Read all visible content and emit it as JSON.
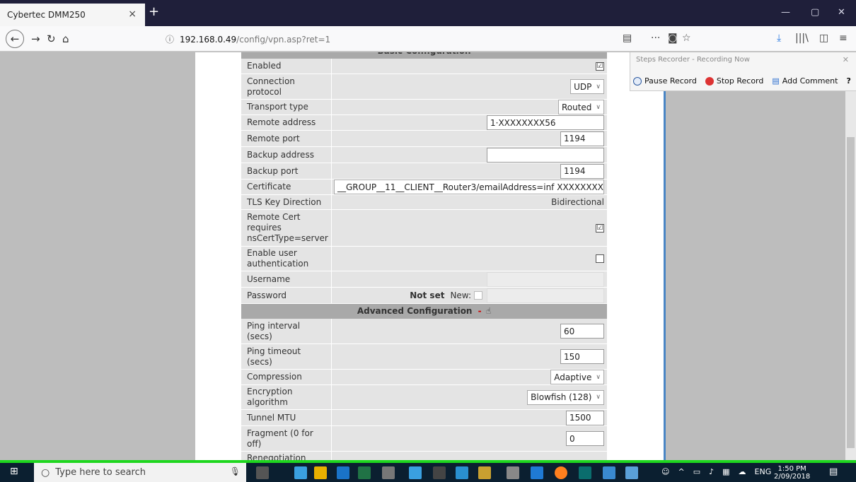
{
  "browser": {
    "tab_title": "Cybertec DMM250",
    "tab_close": "×",
    "new_tab": "+",
    "url_host": "192.168.0.49",
    "url_path": "/config/vpn.asp?ret=1",
    "win_min": "—",
    "win_max": "▢",
    "win_close": "✕"
  },
  "steps_recorder": {
    "title": "Steps Recorder - Recording Now",
    "pause": "Pause Record",
    "stop": "Stop Record",
    "comment": "Add Comment"
  },
  "form": {
    "basic_heading": "Basic Configuration",
    "rows": {
      "enabled": {
        "label": "Enabled",
        "checked": "☑"
      },
      "protocol": {
        "label": "Connection protocol",
        "value": "UDP"
      },
      "transport": {
        "label": "Transport type",
        "value": "Routed"
      },
      "remote_address": {
        "label": "Remote address",
        "value": "1·XXXXXXXX56"
      },
      "remote_port": {
        "label": "Remote port",
        "value": "1194"
      },
      "backup_address": {
        "label": "Backup address",
        "value": ""
      },
      "backup_port": {
        "label": "Backup port",
        "value": "1194"
      },
      "certificate": {
        "label": "Certificate",
        "value": "__GROUP__11__CLIENT__Router3/emailAddress=inf XXXXXXXX"
      },
      "tls": {
        "label": "TLS Key Direction",
        "value": "Bidirectional"
      },
      "remote_cert": {
        "label": "Remote Cert requires nsCertType=server",
        "checked": "☑"
      },
      "user_auth": {
        "label": "Enable user authentication",
        "checked": ""
      },
      "username": {
        "label": "Username"
      },
      "password": {
        "label": "Password",
        "not_set": "Not set",
        "new_label": "New:"
      }
    },
    "advanced_heading": "Advanced Configuration",
    "advanced_toggle": "-",
    "adv_rows": {
      "ping_interval": {
        "label": "Ping interval (secs)",
        "value": "60"
      },
      "ping_timeout": {
        "label": "Ping timeout (secs)",
        "value": "150"
      },
      "compression": {
        "label": "Compression",
        "value": "Adaptive"
      },
      "encryption": {
        "label": "Encryption algorithm",
        "value": "Blowfish (128)"
      },
      "mtu": {
        "label": "Tunnel MTU",
        "value": "1500"
      },
      "fragment": {
        "label": "Fragment (0 for off)",
        "value": "0"
      },
      "reneg": {
        "label": "Renegotiation time"
      }
    }
  },
  "taskbar": {
    "search_placeholder": "Type here to search",
    "lang": "ENG",
    "time": "1:50 PM",
    "date": "2/09/2018"
  }
}
